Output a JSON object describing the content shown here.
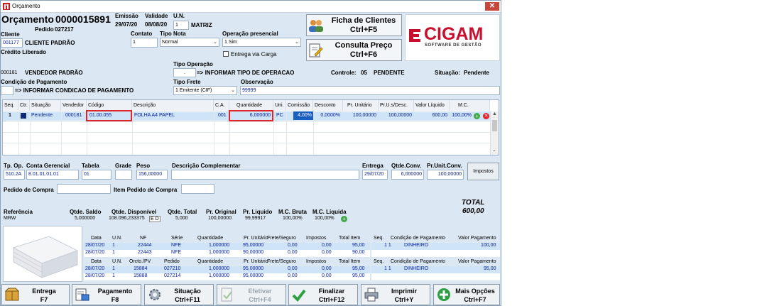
{
  "window": {
    "title": "Orçamento"
  },
  "header": {
    "orcamento_label": "Orçamento",
    "orcamento_number": "0000015891",
    "pedido_label": "Pedido",
    "pedido_number": "027217",
    "emissao_label": "Emissão",
    "emissao_value": "29/07/20",
    "validade_label": "Validade",
    "validade_value": "08/08/20",
    "un_label": "U.N.",
    "un_value": "1",
    "un_name": "MATRIZ"
  },
  "cliente": {
    "label": "Cliente",
    "code": "001177",
    "name": "CLIENTE PADRÃO",
    "status": "Crédito Liberado",
    "contato_label": "Contato",
    "contato_value": "1",
    "tipo_nota_label": "Tipo Nota",
    "tipo_nota_value": "Normal",
    "operacao_label": "Operação presencial",
    "operacao_value": "1 Sim",
    "entrega_carga_label": "Entrega via Carga"
  },
  "top_buttons": {
    "ficha_line1": "Ficha de Clientes",
    "ficha_line2": "Ctrl+F5",
    "consulta_line1": "Consulta Preço",
    "consulta_line2": "Ctrl+F6"
  },
  "logo": {
    "name": "CIGAM",
    "tagline": "SOFTWARE DE GESTÃO"
  },
  "vendedor": {
    "code": "000181",
    "name": "VENDEDOR PADRÃO",
    "tipo_operacao_label": "Tipo Operação",
    "tipo_operacao_value": ".",
    "tipo_operacao_text": "=> INFORMAR TIPO DE OPERACAO",
    "controle_label": "Controle:",
    "controle_value": "05",
    "controle_status": "PENDENTE",
    "situacao_label": "Situação:",
    "situacao_value": "Pendente"
  },
  "condicao": {
    "label": "Condição de Pagamento",
    "text": "=> INFORMAR CONDICAO DE PAGAMENTO",
    "tipo_frete_label": "Tipo Frete",
    "tipo_frete_value": "1 Emitente (CIF)",
    "observacao_label": "Observação",
    "observacao_value": "99999"
  },
  "items_grid": {
    "headers": [
      "Seq.",
      "Ctr.",
      "Situação",
      "Vendedor",
      "Código",
      "Descrição",
      "C.A.",
      "Quantidade",
      "Uni.",
      "Comissão",
      "Desconto",
      "Pr. Unitário",
      "Pr.U.s/Desc.",
      "Valor Líquido",
      "M.C."
    ],
    "row": {
      "seq": "1",
      "situacao": "Pendente",
      "vendedor": "000181",
      "codigo": "01.00.055",
      "descricao": "FOLHA A4 PAPEL",
      "ca": "001",
      "quantidade": "6,000000",
      "uni": "PC",
      "comissao": "4,00%",
      "desconto": "0,0000%",
      "pr_unitario": "100,00000",
      "pr_sdesc": "100,00000",
      "valor_liquido": "600,00",
      "mc": "100,00%"
    }
  },
  "detail": {
    "tp_op_label": "Tp. Op.",
    "tp_op_value": "510.2A",
    "conta_label": "Conta Gerencial",
    "conta_value": "8.01.01.01.01",
    "tabela_label": "Tabela",
    "tabela_value": "01",
    "grade_label": "Grade",
    "peso_label": "Peso",
    "peso_value": "156,00000",
    "desc_compl_label": "Descrição Complementar",
    "entrega_label": "Entrega",
    "entrega_value": "29/07/20",
    "qtde_conv_label": "Qtde.Conv.",
    "qtde_conv_value": "6,000000",
    "pr_unit_conv_label": "Pr.Unit.Conv.",
    "pr_unit_conv_value": "100,00000",
    "impostos_button": "Impostos",
    "pedido_compra_label": "Pedido de Compra",
    "item_pedido_compra_label": "Item Pedido de Compra",
    "total_label": "TOTAL",
    "total_value": "600,00"
  },
  "summary": {
    "referencia_label": "Referência",
    "referencia_value": "MRW",
    "qtde_saldo_label": "Qtde. Saldo",
    "qtde_saldo_value": "5,000000",
    "qtde_disp_label": "Qtde. Disponível",
    "qtde_disp_value": "108.096,233375",
    "qtde_total_label": "Qtde. Total",
    "qtde_total_value": "5,000",
    "pr_original_label": "Pr. Original",
    "pr_original_value": "100,00000",
    "pr_liquido_label": "Pr. Liquido",
    "pr_liquido_value": "99,99917",
    "mc_bruta_label": "M.C. Bruta",
    "mc_bruta_value": "100,00%",
    "mc_liquida_label": "M.C. Liquida",
    "mc_liquida_value": "100,00%",
    "ed_label": "E D"
  },
  "nf_table": {
    "headers": [
      "Data",
      "U.N.",
      "NF",
      "Série",
      "Quantidade",
      "Pr. Unitário",
      "Frete/Seguro",
      "Impostos",
      "Total Item"
    ],
    "rows": [
      [
        "28/07/20",
        "1",
        "22444",
        "NFE",
        "1,000000",
        "95,00000",
        "0,00",
        "0,00",
        "95,00"
      ],
      [
        "28/07/20",
        "1",
        "22443",
        "NFE",
        "1,000000",
        "90,00000",
        "0,00",
        "0,00",
        "90,00"
      ]
    ]
  },
  "pedido_table": {
    "headers": [
      "Data",
      "U.N.",
      "Orcto./PV",
      "Pedido",
      "Quantidade",
      "Pr. Unitário",
      "Frete/Seguro",
      "Impostos",
      "Total Item"
    ],
    "rows": [
      [
        "28/07/20",
        "1",
        "15884",
        "027210",
        "1,000000",
        "95,00000",
        "0,00",
        "0,00",
        "95,00"
      ],
      [
        "28/07/20",
        "1",
        "15888",
        "027214",
        "1,000000",
        "95,00000",
        "0,00",
        "0,00",
        "95,00"
      ]
    ]
  },
  "pagto_table1": {
    "headers": [
      "Seq.",
      "Condição de Pagamento",
      "Valor Pagamento"
    ],
    "row": [
      "1 1",
      "DINHEIRO",
      "100,00"
    ]
  },
  "pagto_table2": {
    "headers": [
      "Seq.",
      "Condição de Pagamento",
      "Valor Pagamento"
    ],
    "row": [
      "1 1",
      "DINHEIRO",
      "95,00"
    ]
  },
  "bottom_buttons": {
    "entrega": [
      "Entrega",
      "F7"
    ],
    "pagamento": [
      "Pagamento",
      "F8"
    ],
    "situacao": [
      "Situação",
      "Ctrl+F11"
    ],
    "efetivar": [
      "Efetivar",
      "Ctrl+F4"
    ],
    "finalizar": [
      "Finalizar",
      "Ctrl+F12"
    ],
    "imprimir": [
      "Imprimir",
      "Ctrl+Y"
    ],
    "mais": [
      "Mais Opções",
      "Ctrl+F7"
    ]
  }
}
